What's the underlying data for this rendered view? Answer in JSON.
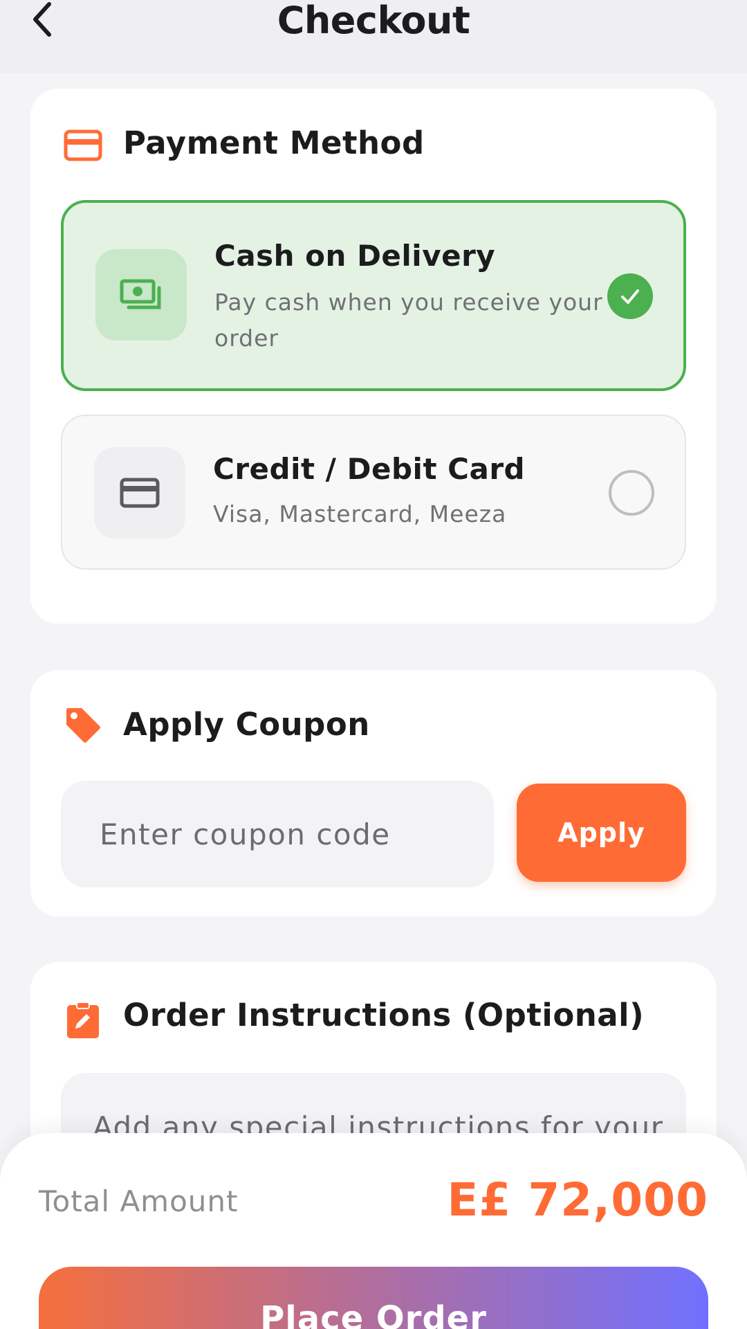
{
  "header": {
    "title": "Checkout",
    "back_icon": "chevron-left-icon"
  },
  "payment": {
    "title": "Payment Method",
    "icon": "credit-card-icon",
    "options": [
      {
        "title": "Cash on Delivery",
        "description": "Pay cash when you receive your order",
        "icon": "cash-icon",
        "selected": true
      },
      {
        "title": "Credit / Debit Card",
        "description": "Visa, Mastercard, Meeza",
        "icon": "credit-card-icon",
        "selected": false
      }
    ]
  },
  "coupon": {
    "title": "Apply Coupon",
    "icon": "tag-icon",
    "placeholder": "Enter coupon code",
    "apply_label": "Apply"
  },
  "instructions": {
    "title": "Order Instructions (Optional)",
    "icon": "clipboard-edit-icon",
    "placeholder": "Add any special instructions for your"
  },
  "summary": {
    "total_label": "Total Amount",
    "total_value": "E£ 72,000",
    "place_order_label": "Place Order"
  },
  "colors": {
    "accent": "#ff6b35",
    "success": "#4caf50",
    "gradient_end": "#7070ff"
  }
}
